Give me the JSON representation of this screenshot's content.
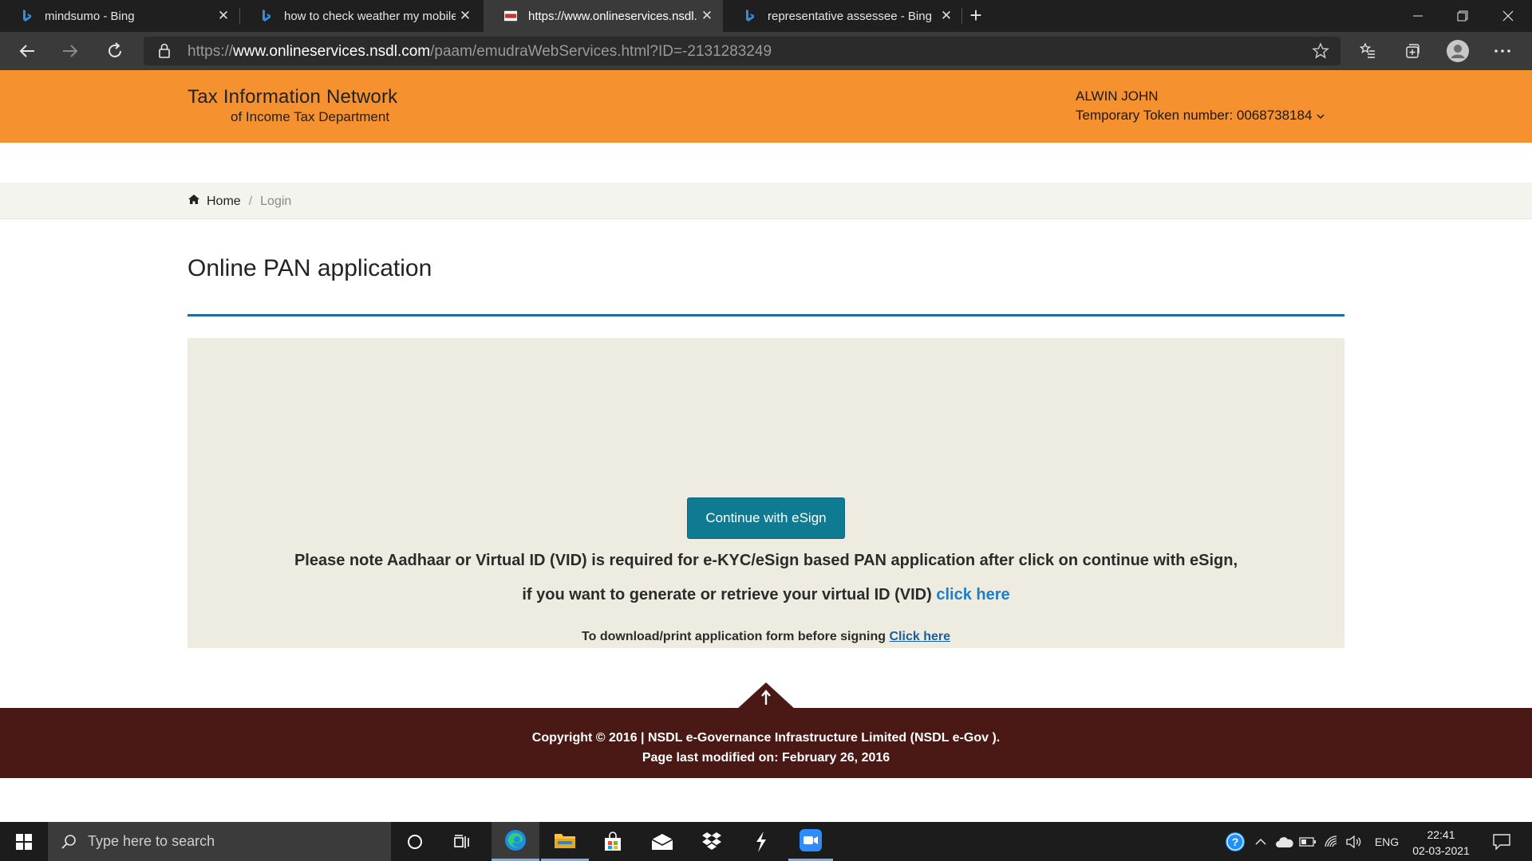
{
  "browser": {
    "tabs": [
      {
        "title": "mindsumo - Bing",
        "favicon": "bing-icon",
        "active": false
      },
      {
        "title": "how to check weather my mobile",
        "favicon": "bing-icon",
        "active": false
      },
      {
        "title": "https://www.onlineservices.nsdl.com",
        "favicon": "nsdl-icon",
        "active": true
      },
      {
        "title": "representative assessee - Bing",
        "favicon": "bing-icon",
        "active": false
      }
    ],
    "address": {
      "scheme": "https://",
      "domain": "www.onlineservices.nsdl.com",
      "path": "/paam/emudraWebServices.html?ID=-2131283249"
    }
  },
  "site": {
    "brand_line1": "Tax Information Network",
    "brand_line2": "of Income Tax Department",
    "user_name": "ALWIN JOHN",
    "token_label": "Temporary Token number: 0068738184",
    "accent": "#f5912f"
  },
  "breadcrumb": {
    "home": "Home",
    "separator": "/",
    "current": "Login"
  },
  "main": {
    "title": "Online PAN application",
    "esign_button": "Continue with eSign",
    "note_line1": "Please note Aadhaar or Virtual ID (VID) is required for e-KYC/eSign based PAN application after click on continue with eSign,",
    "note_line2_prefix": "if you want to generate or retrieve your virtual ID (VID)",
    "note_line2_link": "click here",
    "download_prefix": "To download/print application form before signing",
    "download_link": "Click here"
  },
  "footer": {
    "copyright": "Copyright © 2016 | NSDL e-Governance Infrastructure Limited (NSDL e-Gov ).",
    "modified": "Page last modified on: February 26, 2016",
    "background": "#4a1915"
  },
  "taskbar": {
    "search_placeholder": "Type here to search",
    "language": "ENG",
    "time": "22:41",
    "date": "02-03-2021"
  }
}
